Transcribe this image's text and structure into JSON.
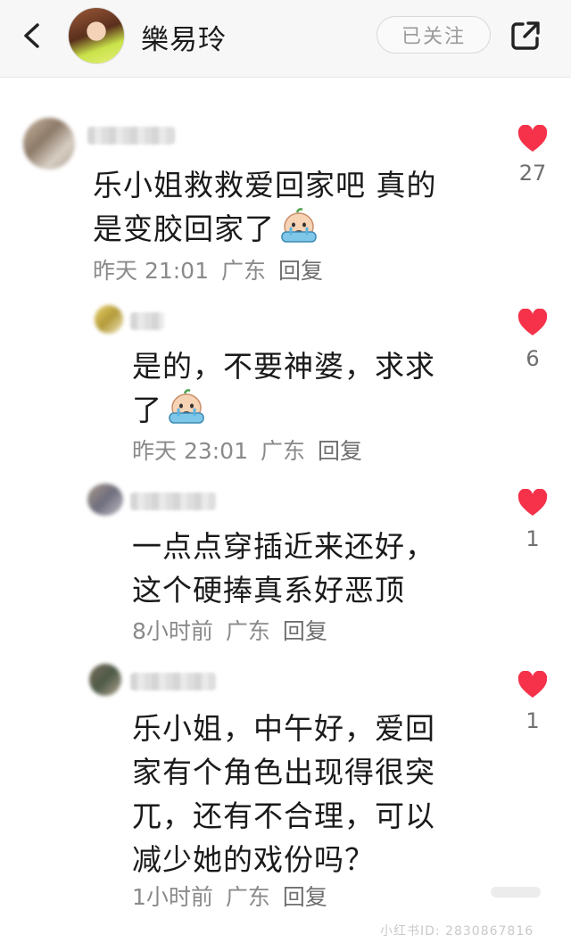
{
  "header": {
    "username": "樂易玲",
    "follow_label": "已关注"
  },
  "comments": [
    {
      "text_lines": [
        "乐小姐救救爱回家吧 真的",
        "是变胶回家了"
      ],
      "emoji": "crying-emoji",
      "time": "昨天 21:01",
      "location": "广东",
      "reply": "回复",
      "likes": "27"
    },
    {
      "text_lines": [
        "是的，不要神婆，求求",
        "了"
      ],
      "emoji": "crying-emoji",
      "time": "昨天 23:01",
      "location": "广东",
      "reply": "回复",
      "likes": "6"
    },
    {
      "text_lines": [
        "一点点穿插近来还好，",
        "这个硬捧真系好恶顶"
      ],
      "time": "8小时前",
      "location": "广东",
      "reply": "回复",
      "likes": "1"
    },
    {
      "text_lines": [
        "乐小姐，中午好，爱回",
        "家有个角色出现得很突",
        "兀，还有不合理，可以",
        "减少她的戏份吗？"
      ],
      "time": "1小时前",
      "location": "广东",
      "reply": "回复",
      "likes": "1"
    }
  ],
  "watermark": "小红书ID: 2830867816",
  "colors": {
    "heart": "#f5324a",
    "meta_text": "#8a8a8a",
    "header_bg": "#f7f7f8"
  }
}
